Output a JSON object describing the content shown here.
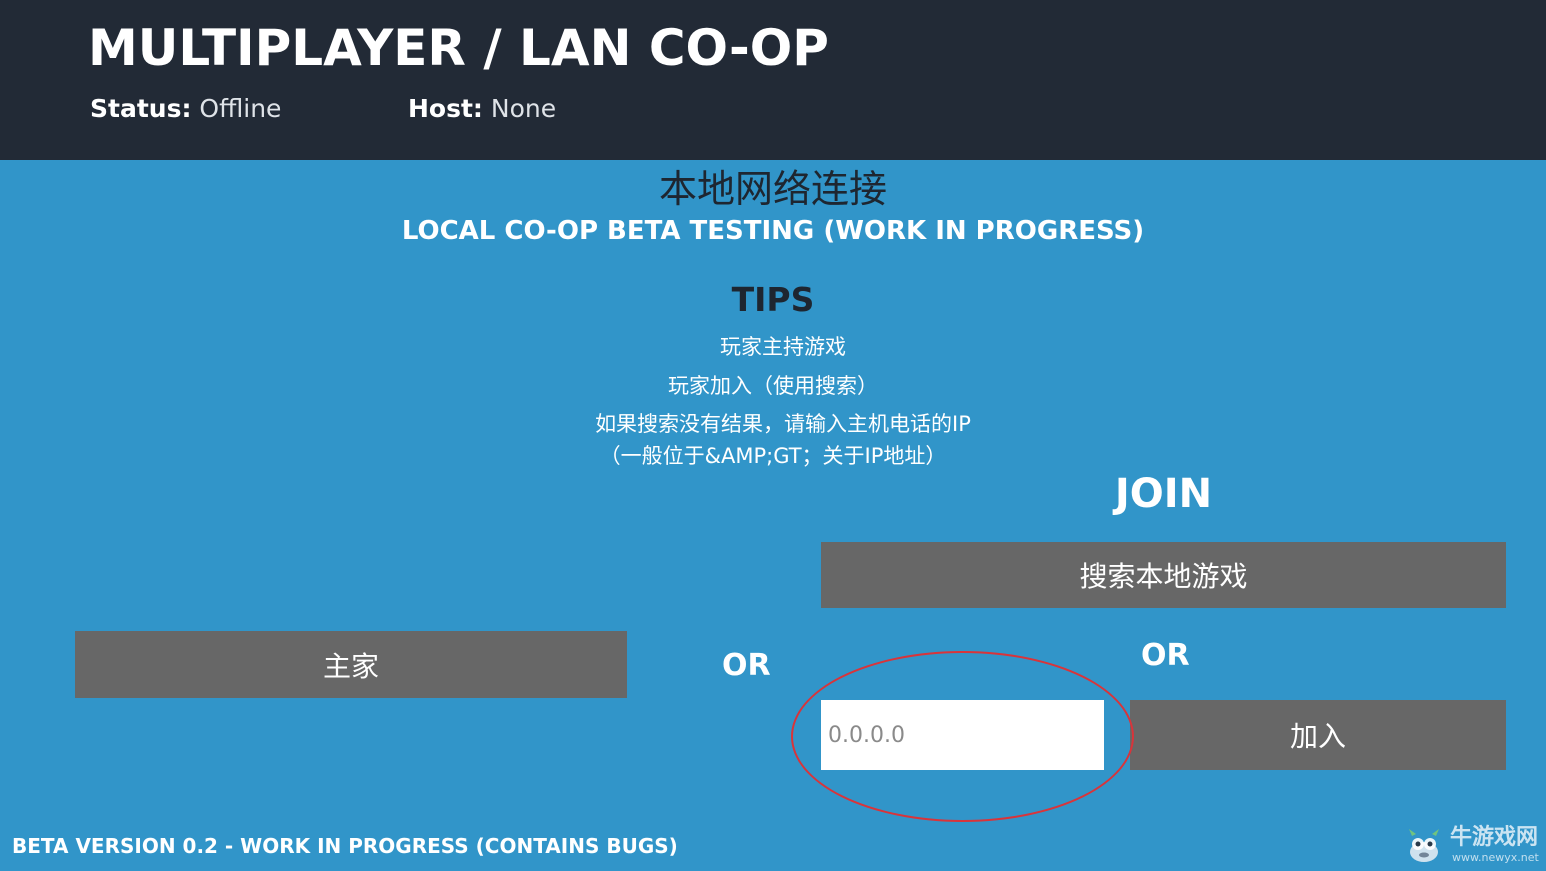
{
  "header": {
    "title": "MULTIPLAYER / LAN CO-OP",
    "status_label": "Status:",
    "status_value": "Offline",
    "host_label": "Host:",
    "host_value": "None"
  },
  "main": {
    "cn_title": "本地网络连接",
    "subtitle": "LOCAL CO-OP BETA TESTING (WORK IN PROGRESS)",
    "tips_title": "TIPS",
    "tips": [
      "玩家主持游戏",
      "玩家加入（使用搜索）",
      "如果搜索没有结果，请输入主机电话的IP",
      "（一般位于&AMP;GT；关于IP地址）"
    ],
    "host_button": "主家",
    "or_left": "OR",
    "join": {
      "title": "JOIN",
      "search_button": "搜索本地游戏",
      "or": "OR",
      "ip_placeholder": "0.0.0.0",
      "join_button": "加入"
    }
  },
  "footer": {
    "version_text": "BETA VERSION 0.2 - WORK IN PROGRESS (CONTAINS BUGS)"
  },
  "watermark": {
    "text": "牛游戏网",
    "url": "www.newyx.net"
  },
  "colors": {
    "background": "#3195c9",
    "header": "#222a36",
    "button": "#676767",
    "highlight": "#d9343a"
  }
}
